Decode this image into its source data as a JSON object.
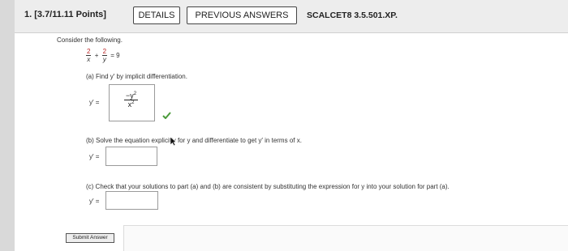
{
  "header": {
    "question_number": "1. [3.7/11.11 Points]",
    "details_label": "DETAILS",
    "previous_answers_label": "PREVIOUS ANSWERS",
    "problem_id": "SCALCET8 3.5.501.XP."
  },
  "problem": {
    "intro": "Consider the following.",
    "equation": {
      "term1_num": "2",
      "term1_den": "x",
      "plus": "+",
      "term2_num": "2",
      "term2_den": "y",
      "equals": "= 9"
    },
    "part_a": {
      "prompt": "(a) Find y′ by implicit differentiation.",
      "label": "y′ =",
      "answer_numerator": "−y",
      "answer_numerator_exp": "2",
      "answer_denominator": "x",
      "answer_denominator_exp": "2",
      "status": "correct"
    },
    "part_b": {
      "prompt": "(b) Solve the equation explicitly for y and differentiate to get y′ in terms of x.",
      "label": "y′ =",
      "value": ""
    },
    "part_c": {
      "prompt": "(c) Check that your solutions to part (a) and (b) are consistent by substituting the expression for y into your solution for part (a).",
      "label": "y′ =",
      "value": ""
    }
  },
  "submit_label": "Submit Answer",
  "colors": {
    "correct_check": "#4a9a3a",
    "header_bg": "#ededed",
    "fraction_highlight": "#b22222"
  }
}
